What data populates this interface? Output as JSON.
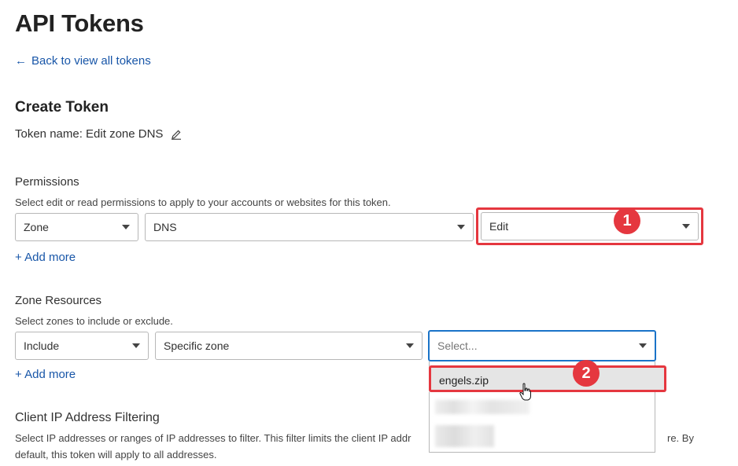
{
  "page_title": "API Tokens",
  "back_link": "Back to view all tokens",
  "section_title": "Create Token",
  "token_name": "Token name: Edit zone DNS",
  "permissions": {
    "label": "Permissions",
    "hint": "Select edit or read permissions to apply to your accounts or websites for this token.",
    "select1": "Zone",
    "select2": "DNS",
    "select3": "Edit",
    "add_more": "+ Add more"
  },
  "zone_resources": {
    "label": "Zone Resources",
    "hint": "Select zones to include or exclude.",
    "select1": "Include",
    "select2": "Specific zone",
    "select3_placeholder": "Select...",
    "add_more": "+ Add more",
    "dropdown_option": "engels.zip"
  },
  "client_ip": {
    "label": "Client IP Address Filtering",
    "hint_line1_start": "Select IP addresses or ranges of IP addresses to filter. This filter limits the client IP addr",
    "hint_line1_end": "re. By",
    "hint_line2": "default, this token will apply to all addresses."
  },
  "annotations": {
    "badge1": "1",
    "badge2": "2",
    "color": "#e5373f"
  },
  "colors": {
    "link": "#1856a8",
    "focus": "#1a73c8"
  }
}
